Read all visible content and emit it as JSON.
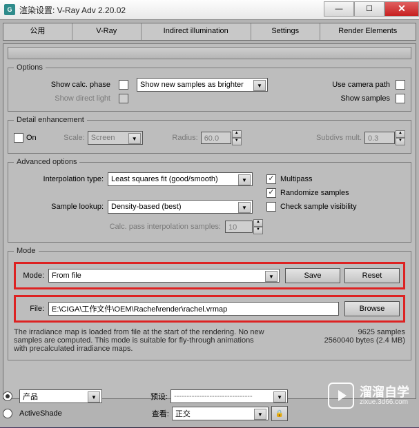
{
  "window": {
    "title": "渲染设置: V-Ray Adv 2.20.02"
  },
  "tabs": {
    "common": "公用",
    "vray": "V-Ray",
    "indirect": "Indirect illumination",
    "settings": "Settings",
    "elements": "Render Elements"
  },
  "options": {
    "legend": "Options",
    "show_calc_phase": "Show calc. phase",
    "show_direct_light": "Show direct light",
    "samples_mode_sel": "Show new samples as brighter",
    "use_camera_path": "Use camera path",
    "show_samples": "Show samples"
  },
  "detail": {
    "legend": "Detail enhancement",
    "on": "On",
    "scale_lbl": "Scale:",
    "scale_val": "Screen",
    "radius_lbl": "Radius:",
    "radius_val": "60.0",
    "subdivs_lbl": "Subdivs mult.",
    "subdivs_val": "0.3"
  },
  "adv": {
    "legend": "Advanced options",
    "interp_lbl": "Interpolation type:",
    "interp_val": "Least squares fit (good/smooth)",
    "sample_lbl": "Sample lookup:",
    "sample_val": "Density-based (best)",
    "calcpass_lbl": "Calc. pass interpolation samples:",
    "calcpass_val": "10",
    "multipass": "Multipass",
    "randomize": "Randomize samples",
    "checksample": "Check sample visibility"
  },
  "mode": {
    "legend": "Mode",
    "mode_lbl": "Mode:",
    "mode_val": "From file",
    "save_btn": "Save",
    "reset_btn": "Reset",
    "file_lbl": "File:",
    "file_val": "E:\\CIGA\\工作文件\\OEM\\Rachel\\render\\rachel.vrmap",
    "browse_btn": "Browse",
    "desc": "The irradiance map is loaded from file at the start of the rendering. No new samples are computed. This mode is suitable for fly-through animations with precalculated irradiance maps.",
    "stat1": "9625 samples",
    "stat2": "2560040 bytes (2.4 MB)"
  },
  "footer": {
    "product": "产品",
    "active": "ActiveShade",
    "preset_lbl": "预设:",
    "preset_placeholder": "-------------------------------",
    "view_lbl": "查看:",
    "view_val": "正交"
  },
  "wm": {
    "t1": "溜溜自学",
    "t2": "zixue.3d66.com"
  }
}
